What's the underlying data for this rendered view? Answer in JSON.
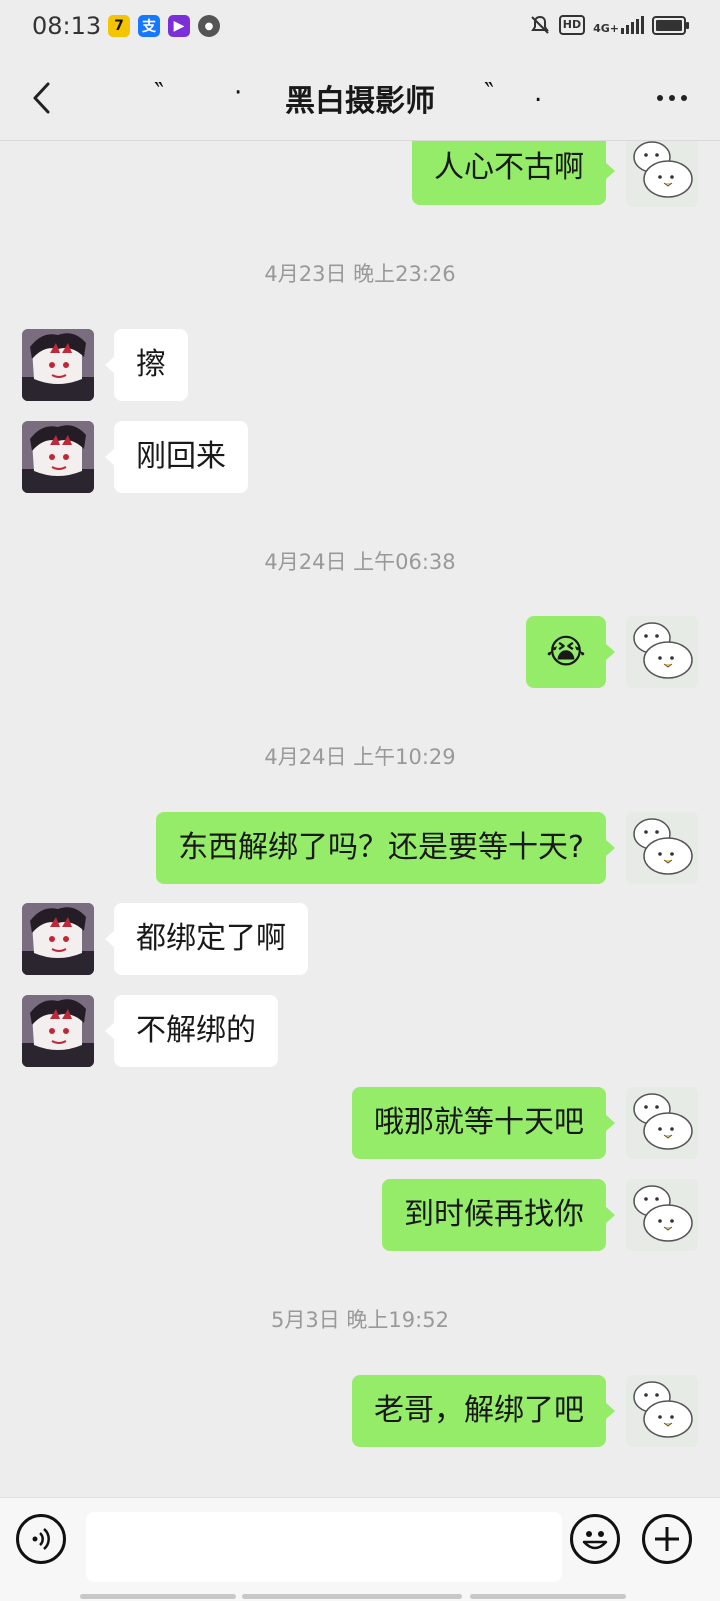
{
  "status_bar": {
    "time": "08:13",
    "apps": [
      {
        "icon": "app-icon-yellow",
        "glyph": "7",
        "color": "#f5c400"
      },
      {
        "icon": "alipay-icon",
        "glyph": "支",
        "color": "#1677ff"
      },
      {
        "icon": "app-icon-purple",
        "glyph": "▶",
        "color": "#7b2fd9"
      },
      {
        "icon": "chat-bubble-icon",
        "glyph": "●",
        "color": "#555555"
      }
    ],
    "hd_label": "HD",
    "network_label": "4G+"
  },
  "header": {
    "title": "黑白摄影师",
    "deco_marks": [
      "‶",
      "·",
      "‶",
      "."
    ]
  },
  "messages": [
    {
      "side": "right",
      "type": "text",
      "text": "人心不古啊"
    },
    {
      "type": "timestamp",
      "text": "4月23日 晚上23:26"
    },
    {
      "side": "left",
      "type": "text",
      "text": "擦"
    },
    {
      "side": "left",
      "type": "text",
      "text": "刚回来"
    },
    {
      "type": "timestamp",
      "text": "4月24日 上午06:38"
    },
    {
      "side": "right",
      "type": "emoji",
      "text": "😭"
    },
    {
      "type": "timestamp",
      "text": "4月24日 上午10:29"
    },
    {
      "side": "right",
      "type": "text",
      "text": "东西解绑了吗？还是要等十天?"
    },
    {
      "side": "left",
      "type": "text",
      "text": "都绑定了啊"
    },
    {
      "side": "left",
      "type": "text",
      "text": "不解绑的"
    },
    {
      "side": "right",
      "type": "text",
      "text": "哦那就等十天吧"
    },
    {
      "side": "right",
      "type": "text",
      "text": "到时候再找你"
    },
    {
      "type": "timestamp",
      "text": "5月3日 晚上19:52"
    },
    {
      "side": "right",
      "type": "text",
      "text": "老哥，解绑了吧"
    }
  ],
  "input_bar": {
    "voice_icon": "voice-icon",
    "emoji_icon": "emoji-icon",
    "plus_icon": "plus-icon",
    "text_value": ""
  },
  "colors": {
    "background": "#ededed",
    "sent_bubble": "#95ec69",
    "received_bubble": "#ffffff"
  }
}
